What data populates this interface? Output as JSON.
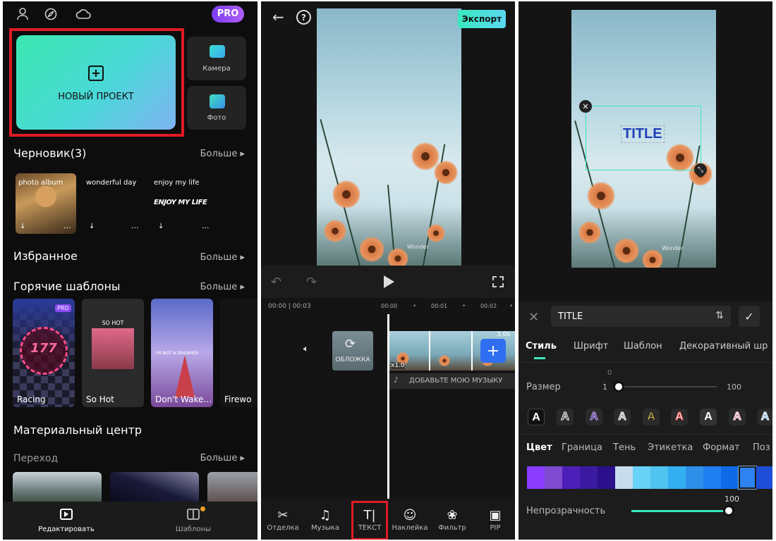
{
  "panel1": {
    "pro_badge": "PRO",
    "new_project": "НОВЫЙ ПРОЕКТ",
    "camera": "Камера",
    "photo": "Фото",
    "drafts_title": "Черновик(3)",
    "more": "Больше",
    "drafts": [
      {
        "label": "photo album"
      },
      {
        "label": "wonderful day"
      },
      {
        "label": "enjoy my life",
        "art": "ENJOY MY LIFE"
      }
    ],
    "favorites_title": "Избранное",
    "hot_templates_title": "Горячие шаблоны",
    "templates": [
      {
        "name": "Racing",
        "number": "177",
        "pro": "PRO"
      },
      {
        "name": "So Hot",
        "overlay": "SO HOT"
      },
      {
        "name": "Don't Wake...",
        "overlay": "I'M NOT A DREAMER"
      },
      {
        "name": "Firewo"
      }
    ],
    "material_center": "Материальный центр",
    "transition": "Переход",
    "nav_edit": "Редактировать",
    "nav_templates": "Шаблоны"
  },
  "panel2": {
    "export": "Экспорт",
    "time_current": "00:00 | 00:03",
    "ticks": [
      "00:00",
      "00:01",
      "00:02"
    ],
    "clip_duration": "3.0s",
    "speed": "x1.0",
    "cover": "ОБЛОЖКА",
    "add_music": "ДОБАВЬТЕ МОЮ МУЗЫКУ",
    "watermark": "Wonder",
    "tools": [
      {
        "label": "Отделка",
        "icon": "✂"
      },
      {
        "label": "Музыка",
        "icon": "♫"
      },
      {
        "label": "ТЕКСТ",
        "icon": "T|"
      },
      {
        "label": "Наклейка",
        "icon": "☺"
      },
      {
        "label": "Фильтр",
        "icon": "❀"
      },
      {
        "label": "PIP",
        "icon": "▣"
      }
    ]
  },
  "panel3": {
    "title_overlay": "TITLE",
    "text_input": "TITLE",
    "tabs": [
      "Стиль",
      "Шрифт",
      "Шаблон",
      "Декоративный шр"
    ],
    "size_label": "Размер",
    "size_min": "1",
    "size_max": "100",
    "size_value": "0",
    "size_fraction": 0.0,
    "style_letter": "A",
    "subtabs": [
      "Цвет",
      "Граница",
      "Тень",
      "Этикетка",
      "Формат",
      "Поз"
    ],
    "opacity_label": "Непрозрачность",
    "opacity_value": "100",
    "opacity_fraction": 1.0,
    "colors": [
      "#8a3cff",
      "#7d4ad0",
      "#4b1fb8",
      "#3a1aa0",
      "#2c0f8a",
      "#c7dcee",
      "#68d1f5",
      "#4fc4f0",
      "#33aef0",
      "#2e8fe8",
      "#1f7ff0",
      "#0f6ae8",
      "#2e83f0",
      "#1f4fd8"
    ]
  }
}
